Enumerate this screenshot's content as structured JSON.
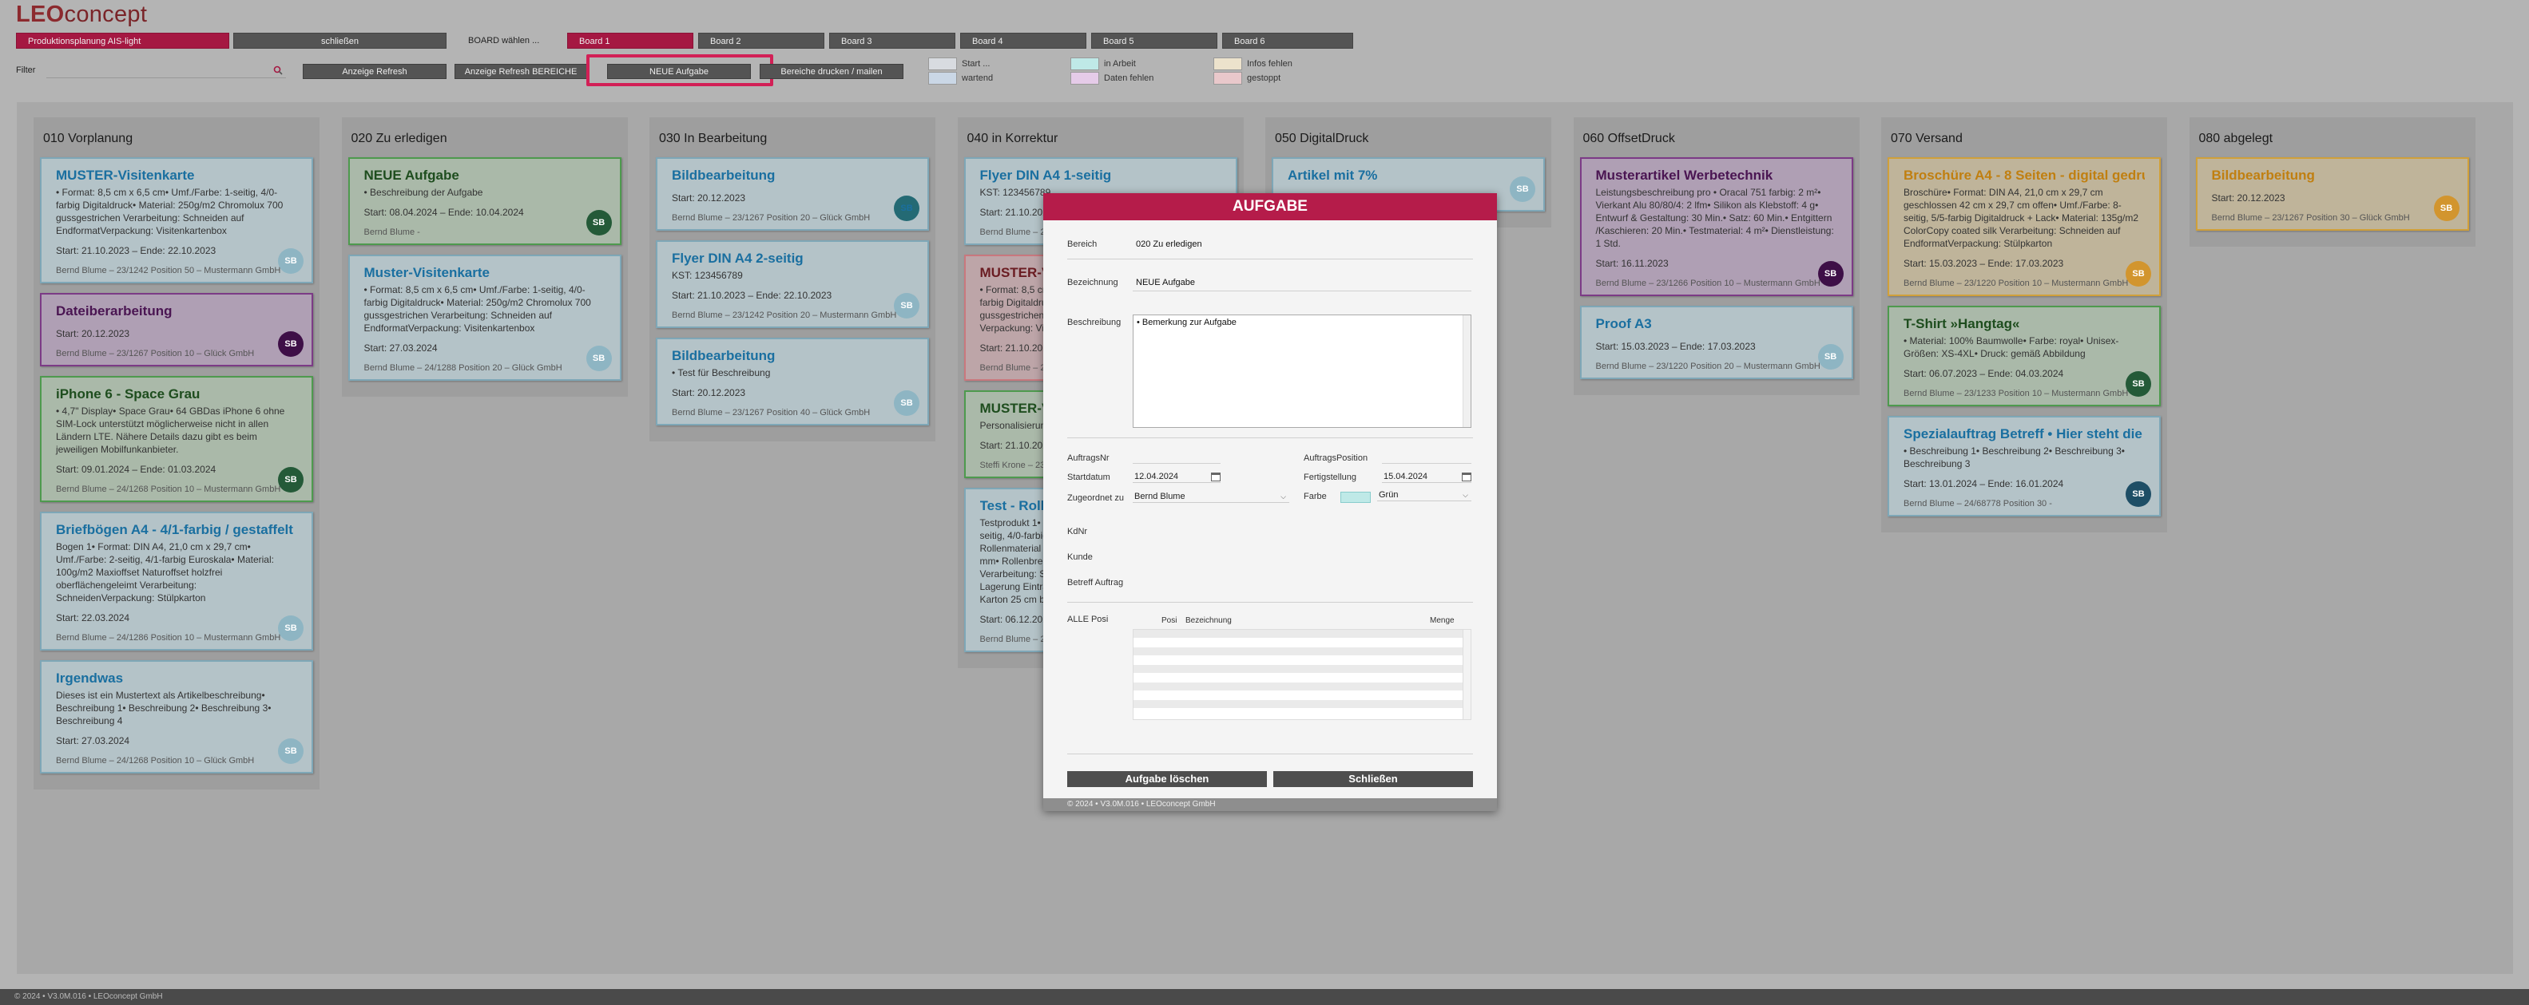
{
  "app": {
    "logo_a": "LEO",
    "logo_b": "concept",
    "title_tab": "Produktionsplanung AIS-light",
    "close_tab": "schließen",
    "board_label": "BOARD wählen ...",
    "status_text": "© 2024 • V3.0M.016 • LEOconcept GmbH"
  },
  "boards": [
    "Board 1",
    "Board 2",
    "Board 3",
    "Board 4",
    "Board 5",
    "Board 6"
  ],
  "filter": {
    "label": "Filter",
    "value": ""
  },
  "toolbar": {
    "refresh": "Anzeige Refresh",
    "refresh_area": "Anzeige Refresh BEREICHE",
    "new_task": "NEUE Aufgabe",
    "print": "Bereiche drucken / mailen"
  },
  "legend": [
    {
      "label": "Start ...",
      "color": "#d8dbe0"
    },
    {
      "label": "wartend",
      "color": "#cad7e6"
    },
    {
      "label": "in Arbeit",
      "color": "#bfe9e7"
    },
    {
      "label": "Daten fehlen",
      "color": "#e5cbe8"
    },
    {
      "label": "Infos fehlen",
      "color": "#ece2cc"
    },
    {
      "label": "gestoppt",
      "color": "#e9c8cb"
    }
  ],
  "columns": [
    {
      "title": "010 Vorplanung",
      "cards": [
        {
          "title": "MUSTER-Visitenkarte",
          "desc": "• Format: 8,5 cm x 6,5 cm• Umf./Farbe: 1-seitig, 4/0-farbig Digitaldruck• Material: 250g/m2 Chromolux 700 gussgestrichen Verarbeitung: Schneiden auf EndformatVerpackung: Visitenkartenbox",
          "dates": "Start: 21.10.2023 – Ende: 22.10.2023",
          "footer": "Bernd Blume – 23/1242 Position 50 – Mustermann GmbH",
          "avatar": "SB",
          "color": "blue",
          "av": "l"
        },
        {
          "title": "Dateiberarbeitung",
          "desc": "",
          "dates": "Start: 20.12.2023",
          "footer": "Bernd Blume – 23/1267 Position 10 – Glück GmbH",
          "avatar": "SB",
          "color": "purple",
          "av": "p"
        },
        {
          "title": "iPhone 6 - Space Grau",
          "desc": "• 4,7\" Display• Space Grau• 64 GBDas iPhone 6 ohne SIM-Lock unterstützt möglicherweise nicht in allen Ländern LTE. Nähere Details dazu gibt es beim jeweiligen Mobilfunkanbieter.",
          "dates": "Start: 09.01.2024 – Ende: 01.03.2024",
          "footer": "Bernd Blume – 24/1268 Position 10 – Mustermann GmbH",
          "avatar": "SB",
          "color": "green",
          "av": "g"
        },
        {
          "title": "Briefbögen A4 - 4/1-farbig / gestaffelt",
          "desc": "Bogen 1• Format: DIN A4, 21,0 cm x 29,7 cm• Umf./Farbe: 2-seitig, 4/1-farbig Euroskala• Material: 100g/m2 Maxioffset Naturoffset holzfrei oberflächengeleimt Verarbeitung: SchneidenVerpackung: Stülpkarton",
          "dates": "Start: 22.03.2024",
          "footer": "Bernd Blume – 24/1286 Position 10 – Mustermann GmbH",
          "avatar": "SB",
          "color": "blue",
          "av": "l"
        },
        {
          "title": "Irgendwas",
          "desc": "Dieses ist ein Mustertext als Artikelbeschreibung• Beschreibung 1• Beschreibung 2• Beschreibung 3• Beschreibung 4",
          "dates": "Start: 27.03.2024",
          "footer": "Bernd Blume – 24/1268 Position 10 – Glück GmbH",
          "avatar": "SB",
          "color": "blue",
          "av": "l"
        }
      ]
    },
    {
      "title": "020 Zu erledigen",
      "cards": [
        {
          "title": "NEUE Aufgabe",
          "desc": "• Beschreibung der Aufgabe",
          "dates": "Start: 08.04.2024 – Ende: 10.04.2024",
          "footer": "Bernd Blume -",
          "avatar": "SB",
          "color": "green",
          "av": "g"
        },
        {
          "title": "Muster-Visitenkarte",
          "desc": "• Format: 8,5 cm x 6,5 cm• Umf./Farbe: 1-seitig, 4/0-farbig Digitaldruck• Material: 250g/m2 Chromolux 700 gussgestrichen Verarbeitung: Schneiden auf EndformatVerpackung: Visitenkartenbox",
          "dates": "Start: 27.03.2024",
          "footer": "Bernd Blume – 24/1288 Position 20 – Glück GmbH",
          "avatar": "SB",
          "color": "blue",
          "av": "l"
        }
      ]
    },
    {
      "title": "030 In Bearbeitung",
      "cards": [
        {
          "title": "Bildbearbeitung",
          "desc": "",
          "dates": "Start: 20.12.2023",
          "footer": "Bernd Blume – 23/1267 Position 20 – Glück GmbH",
          "avatar": "SB",
          "color": "blue",
          "av": "t"
        },
        {
          "title": "Flyer DIN A4 2-seitig",
          "desc": "KST: 123456789",
          "dates": "Start: 21.10.2023 – Ende: 22.10.2023",
          "footer": "Bernd Blume – 23/1242 Position 20 – Mustermann GmbH",
          "avatar": "SB",
          "color": "blue",
          "av": "l"
        },
        {
          "title": "Bildbearbeitung",
          "desc": "• Test für Beschreibung",
          "dates": "Start: 20.12.2023",
          "footer": "Bernd Blume – 23/1267 Position 40 – Glück GmbH",
          "avatar": "SB",
          "color": "blue",
          "av": "l"
        }
      ]
    },
    {
      "title": "040 in Korrektur",
      "cards": [
        {
          "title": "Flyer DIN A4 1-seitig",
          "desc": "KST: 123456789",
          "dates": "Start: 21.10.2023",
          "footer": "Bernd Blume – 23/1242 Position 10 – Mustermann GmbH",
          "avatar": "SB",
          "color": "blue",
          "av": "l"
        },
        {
          "title": "MUSTER-Visitenkarte",
          "desc": "• Format: 8,5 cm x 6,5 cm• Umf./Farbe: 1-seitig, 4/0-farbig Digitaldruck• Material: 250g/m2 Chromolux 700 gussgestrichen Verarbeitung: Schneiden auf Endformat Verpackung: Visitenkartenbox",
          "dates": "Start: 21.10.2023",
          "footer": "Bernd Blume – 23/1242 Position 40 – Mustermann GmbH",
          "avatar": "SB",
          "color": "red",
          "av": "l"
        },
        {
          "title": "MUSTER-Visitenkarte",
          "desc": "Personalisierung: ja Funktion/Zweck: Visitenkarte",
          "dates": "Start: 21.10.2023",
          "footer": "Steffi Krone – 23/1242 Position 30 – Mustermann GmbH",
          "avatar": "SK",
          "color": "green",
          "av": "g"
        },
        {
          "title": "Test - Rollenetiketten",
          "desc": "Testprodukt 1• Format: 10,0 cm x 5,0 cm• Umf./Farbe: 1-seitig, 4/0-farbig Euroskala• Material: 90g/m2 Test-Rollenmaterial Rollenbreite: 11 cm Etikettenabstand: 3 mm• Rollenbreite: Wickelrichtung: außen, Kopf voraus Verarbeitung: Stanzen Verpackung: Manufaktur / Lagerung Eintrag Fremdleistung Beigabe: Rollen im Karton 25 cm breit gewickelt ohne Frachtkosten",
          "dates": "Start: 06.12.2023",
          "footer": "Bernd Blume – 23/1262 Position 10 – Mustermann GmbH",
          "avatar": "SB",
          "color": "blue",
          "av": "l"
        }
      ]
    },
    {
      "title": "050 DigitalDruck",
      "cards": [
        {
          "title": "Artikel mit 7%",
          "desc": "",
          "dates": "",
          "footer": "Bernd Blume – 23/1255 Position 10 – Glück GmbH",
          "avatar": "SB",
          "color": "blue",
          "av": "l"
        }
      ]
    },
    {
      "title": "060 OffsetDruck",
      "cards": [
        {
          "title": "Musterartikel Werbetechnik",
          "desc": "Leistungsbeschreibung pro • Oracal 751 farbig: 2 m²• Vierkant Alu 80/80/4: 2 lfm• Silikon als Klebstoff: 4 g• Entwurf & Gestaltung: 30 Min.• Satz: 60 Min.• Entgittern /Kaschieren: 20 Min.• Testmaterial: 4 m²• Dienstleistung: 1 Std.",
          "dates": "Start: 16.11.2023",
          "footer": "Bernd Blume – 23/1266 Position 10 – Mustermann GmbH",
          "avatar": "SB",
          "color": "purple",
          "av": "p"
        },
        {
          "title": "Proof A3",
          "desc": "",
          "dates": "Start: 15.03.2023 – Ende: 17.03.2023",
          "footer": "Bernd Blume – 23/1220 Position 20 – Mustermann GmbH",
          "avatar": "SB",
          "color": "blue",
          "av": "l"
        }
      ]
    },
    {
      "title": "070 Versand",
      "cards": [
        {
          "title": "Broschüre A4 - 8 Seiten - digital gedruckt",
          "desc": "Broschüre• Format: DIN A4, 21,0 cm x 29,7 cm geschlossen 42 cm x 29,7 cm offen• Umf./Farbe: 8-seitig, 5/5-farbig Digitaldruck + Lack• Material: 135g/m2 ColorCopy coated silk Verarbeitung: Schneiden auf EndformatVerpackung: Stülpkarton",
          "dates": "Start: 15.03.2023 – Ende: 17.03.2023",
          "footer": "Bernd Blume – 23/1220 Position 10 – Mustermann GmbH",
          "avatar": "SB",
          "color": "orange",
          "av": "o"
        },
        {
          "title": "T-Shirt »Hangtag«",
          "desc": "• Material: 100% Baumwolle• Farbe: royal• Unisex-Größen: XS-4XL• Druck: gemäß Abbildung",
          "dates": "Start: 06.07.2023 – Ende: 04.03.2024",
          "footer": "Bernd Blume – 23/1233 Position 10 – Mustermann GmbH",
          "avatar": "SB",
          "color": "green",
          "av": "g"
        },
        {
          "title": "Spezialauftrag Betreff • Hier steht die Info",
          "desc": "• Beschreibung 1• Beschreibung 2• Beschreibung 3• Beschreibung 3",
          "dates": "Start: 13.01.2024 – Ende: 16.01.2024",
          "footer": "Bernd Blume – 24/68778 Position 30 -",
          "avatar": "SB",
          "color": "blue",
          "av": "dk"
        }
      ]
    },
    {
      "title": "080 abgelegt",
      "cards": [
        {
          "title": "Bildbearbeitung",
          "desc": "",
          "dates": "Start: 20.12.2023",
          "footer": "Bernd Blume – 23/1267 Position 30 – Glück GmbH",
          "avatar": "SB",
          "color": "orange",
          "av": "o"
        }
      ]
    }
  ],
  "modal": {
    "title": "AUFGABE",
    "bereich_label": "Bereich",
    "bereich": "020 Zu erledigen",
    "bez_label": "Bezeichnung",
    "bez": "NEUE Aufgabe",
    "beschr_label": "Beschreibung",
    "beschr": "• Bemerkung zur Aufgabe",
    "auftragsnr_label": "AuftragsNr",
    "auftragspos_label": "AuftragsPosition",
    "start_label": "Startdatum",
    "start": "12.04.2024",
    "fertig_label": "Fertigstellung",
    "fertig": "15.04.2024",
    "zugeordnet_label": "Zugeordnet zu",
    "zugeordnet": "Bernd Blume",
    "farbe_label": "Farbe",
    "farbe": "Grün",
    "farbe_color": "#bfe9e7",
    "kdnr_label": "KdNr",
    "kunde_label": "Kunde",
    "betreff_label": "Betreff Auftrag",
    "alle_pos_label": "ALLE Posi",
    "col_pos": "Posi",
    "col_bez": "Bezeichnung",
    "col_menge": "Menge",
    "delete_btn": "Aufgabe löschen",
    "close_btn": "Schließen",
    "footer": "© 2024 • V3.0M.016 • LEOconcept GmbH"
  }
}
